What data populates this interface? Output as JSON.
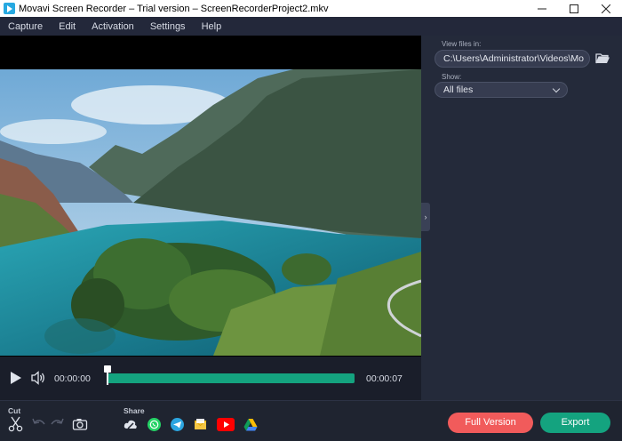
{
  "window": {
    "title": "Movavi Screen Recorder – Trial version – ScreenRecorderProject2.mkv",
    "controls": [
      "minimize",
      "maximize",
      "close"
    ]
  },
  "menu": {
    "items": [
      {
        "label": "Capture"
      },
      {
        "label": "Edit"
      },
      {
        "label": "Activation"
      },
      {
        "label": "Settings"
      },
      {
        "label": "Help"
      }
    ]
  },
  "panel": {
    "view_files_label": "View files in:",
    "path_value": "C:\\Users\\Administrator\\Videos\\Mo",
    "show_label": "Show:",
    "show_value": "All files"
  },
  "player": {
    "current_time": "00:00:00",
    "end_time": "00:00:07",
    "progress_fraction": 0.0
  },
  "toolbar": {
    "cut_label": "Cut",
    "share_label": "Share",
    "share_targets": [
      "cloud-upload-icon",
      "whatsapp-icon",
      "telegram-icon",
      "email-icon",
      "youtube-icon",
      "google-drive-icon"
    ],
    "full_version_label": "Full Version",
    "export_label": "Export"
  },
  "colors": {
    "accent_green": "#14a37f",
    "accent_red": "#f15b5b",
    "background": "#1f2430",
    "panel_bg": "#242a3a"
  }
}
